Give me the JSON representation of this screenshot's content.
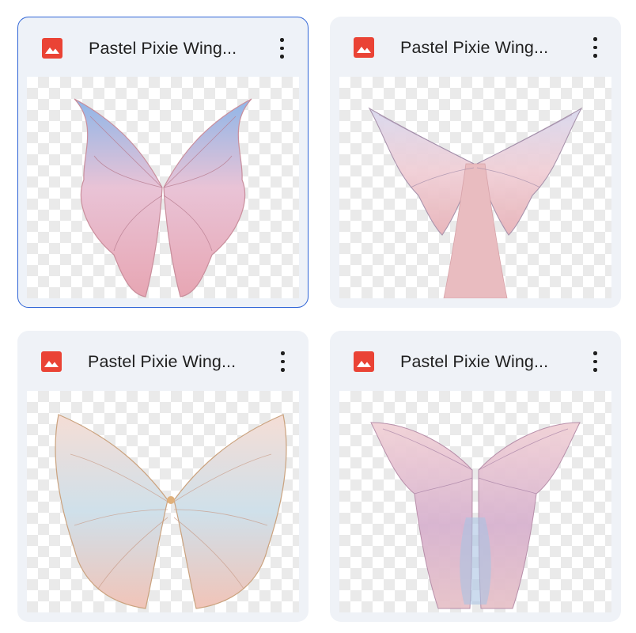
{
  "files": [
    {
      "title": "Pastel Pixie Wing...",
      "type_icon": "image-file-icon",
      "selected": true
    },
    {
      "title": "Pastel Pixie Wing...",
      "type_icon": "image-file-icon",
      "selected": false
    },
    {
      "title": "Pastel Pixie Wing...",
      "type_icon": "image-file-icon",
      "selected": false
    },
    {
      "title": "Pastel Pixie Wing...",
      "type_icon": "image-file-icon",
      "selected": false
    }
  ],
  "colors": {
    "accent_selected": "#2f64d6",
    "card_bg": "#eff2f7",
    "image_icon_red": "#ea4335"
  }
}
